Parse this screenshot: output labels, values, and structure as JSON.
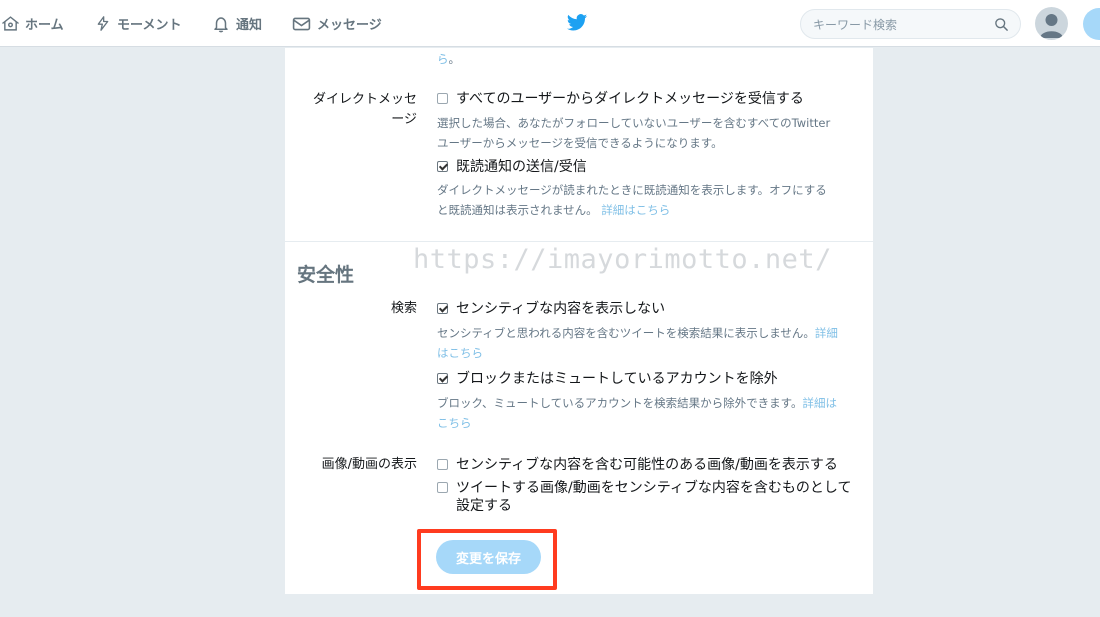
{
  "nav": {
    "home": "ホーム",
    "moments": "モーメント",
    "notifications": "通知",
    "messages": "メッセージ"
  },
  "search": {
    "placeholder": "キーワード検索"
  },
  "top_fragment": {
    "link_tail": "ら",
    "tail": "。"
  },
  "direct_messages": {
    "label_line1": "ダイレクトメッセ",
    "label_line2": "ージ",
    "opt_receive_all": {
      "label": "すべてのユーザーからダイレクトメッセージを受信する",
      "checked": false
    },
    "receive_desc_line1": "選択した場合、あなたがフォローしていないユーザーを含むすべてのTwitter",
    "receive_desc_line2": "ユーザーからメッセージを受信できるようになります。",
    "opt_read_receipts": {
      "label": "既読通知の送信/受信",
      "checked": true
    },
    "read_desc_line1": "ダイレクトメッセージが読まれたときに既読通知を表示します。オフにする",
    "read_desc_line2": "と既読通知は表示されません。",
    "read_link": "詳細はこちら"
  },
  "safety": {
    "title": "安全性",
    "search_label": "検索",
    "opt_hide_sensitive": {
      "label": "センシティブな内容を表示しない",
      "checked": true
    },
    "hide_desc_line1": "センシティブと思われる内容を含むツイートを検索結果に表示しません。",
    "hide_link_line1": "詳細",
    "hide_link_line2": "はこちら",
    "opt_exclude_blocked": {
      "label": "ブロックまたはミュートしているアカウントを除外",
      "checked": true
    },
    "exclude_desc_line1": "ブロック、ミュートしているアカウントを検索結果から除外できます。",
    "exclude_link_line1": "詳細は",
    "exclude_link_line2": "こちら",
    "media_label": "画像/動画の表示",
    "opt_show_media": {
      "label": "センシティブな内容を含む可能性のある画像/動画を表示する",
      "checked": false
    },
    "opt_mark_media_line1": "ツイートする画像/動画をセンシティブな内容を含むものとして",
    "opt_mark_media_line2": "設定する",
    "opt_mark_media_checked": false
  },
  "watermark": "https://imayorimotto.net/",
  "save_button": "変更を保存",
  "colors": {
    "accent": "#1da1f2",
    "button_disabled": "#a6d8f9",
    "highlight": "#ff3b1f",
    "link": "#7fbfe6"
  }
}
